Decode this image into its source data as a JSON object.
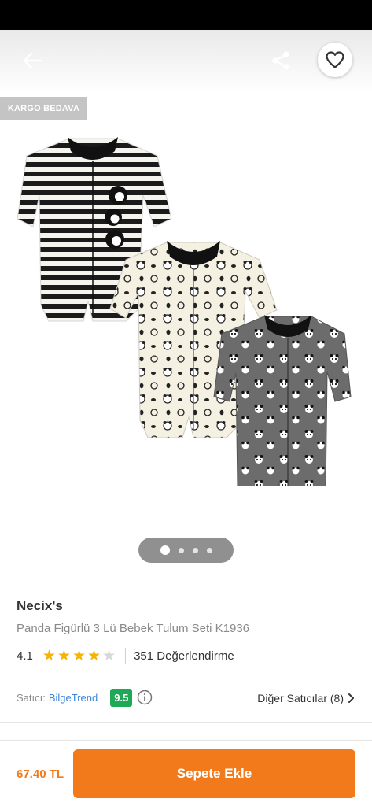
{
  "header": {
    "back_icon": "arrow-left-icon",
    "share_icon": "share-icon",
    "favorite_icon": "heart-icon"
  },
  "badge": {
    "label": "KARGO BEDAVA"
  },
  "gallery": {
    "page_count": 4,
    "current_page": 1
  },
  "product": {
    "brand": "Necix's",
    "title": "Panda Figürlü 3 Lü Bebek Tulum Seti K1936",
    "rating": "4.1",
    "rating_value": 4.1,
    "reviews": "351 Değerlendirme"
  },
  "seller": {
    "label": "Satıcı:",
    "name": "BilgeTrend",
    "score": "9.5",
    "other_sellers": "Diğer Satıcılar (8)"
  },
  "footer": {
    "price": "67.40 TL",
    "add_to_cart": "Sepete Ekle"
  },
  "colors": {
    "accent": "#f27a1a",
    "seller_link": "#3d85d6",
    "score_badge": "#1fa855",
    "star": "#f4b400"
  }
}
